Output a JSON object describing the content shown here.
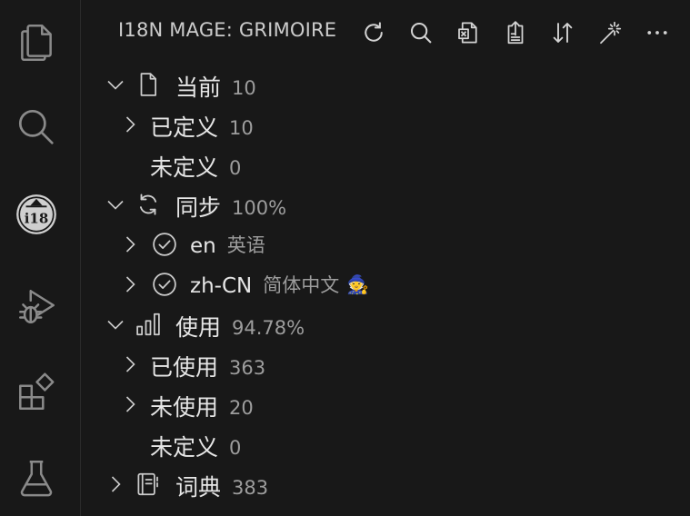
{
  "header": {
    "title": "I18N MAGE: GRIMOIRE"
  },
  "tree": {
    "current": {
      "label": "当前",
      "count": "10"
    },
    "defined": {
      "label": "已定义",
      "count": "10"
    },
    "undefined": {
      "label": "未定义",
      "count": "0"
    },
    "sync": {
      "label": "同步",
      "percent": "100%"
    },
    "lang_en": {
      "code": "en",
      "name": "英语"
    },
    "lang_zh": {
      "code": "zh-CN",
      "name": "简体中文",
      "badge": "🧙"
    },
    "usage": {
      "label": "使用",
      "percent": "94.78%"
    },
    "used": {
      "label": "已使用",
      "count": "363"
    },
    "unused": {
      "label": "未使用",
      "count": "20"
    },
    "usage_undefined": {
      "label": "未定义",
      "count": "0"
    },
    "dictionary": {
      "label": "词典",
      "count": "383"
    }
  },
  "icons": {
    "activity_bar": [
      "explorer-icon",
      "search-icon",
      "i18n-extension-icon",
      "run-debug-icon",
      "extensions-icon",
      "testing-icon"
    ],
    "toolbar": [
      "refresh-icon",
      "search-icon",
      "excel-export-icon",
      "export-icon",
      "sort-icon",
      "magic-wand-icon",
      "more-icon"
    ]
  },
  "colors": {
    "background": "#181818",
    "text": "#e6e6e6",
    "description": "#9d9d9d",
    "icon": "#cccccc"
  }
}
